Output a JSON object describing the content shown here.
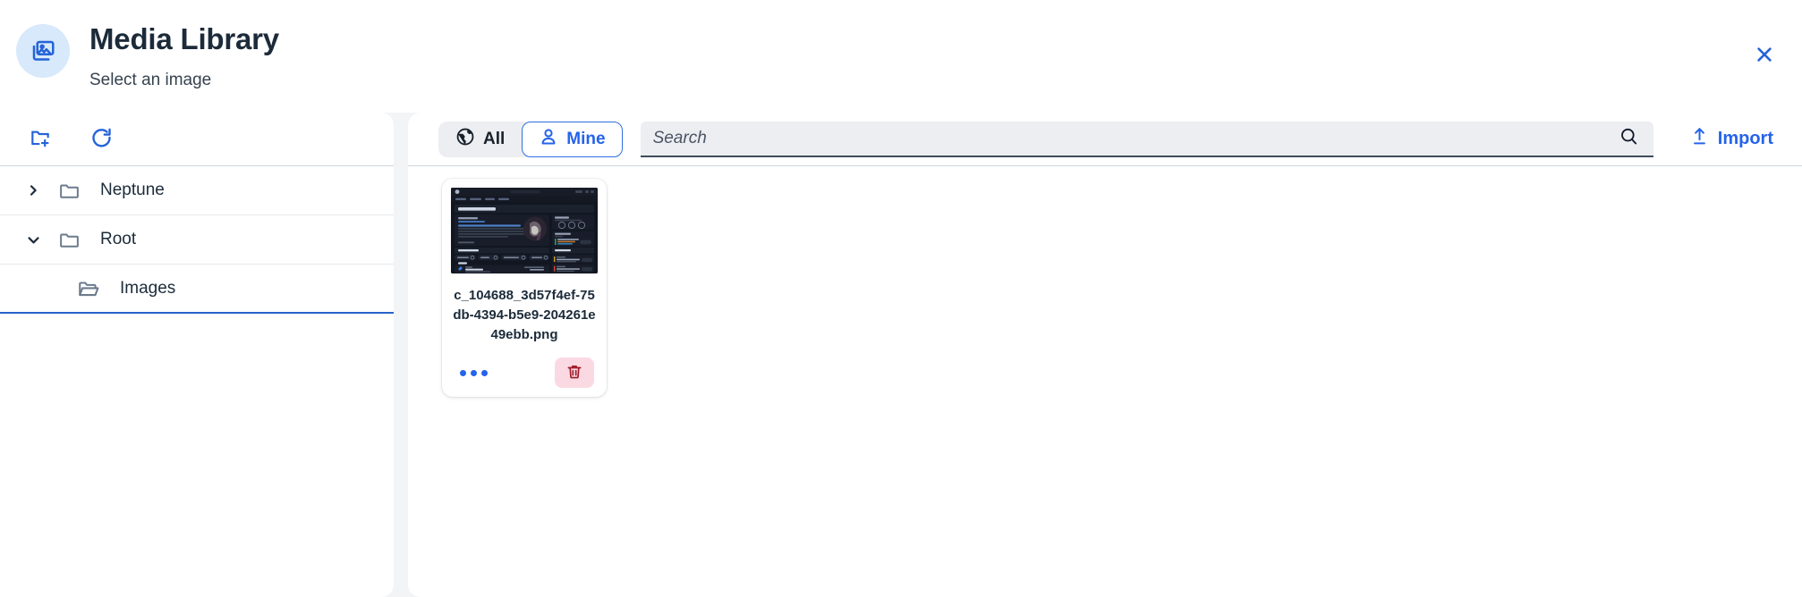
{
  "header": {
    "icon": "media-images-icon",
    "title": "Media Library",
    "subtitle": "Select an image",
    "close_label": "×",
    "badge_bg": "#d7e9fb",
    "accent": "#2563eb",
    "title_color": "#1c2b3a"
  },
  "sidebar": {
    "toolbar": {
      "new_folder_icon": "folder-plus-icon",
      "refresh_icon": "refresh-icon"
    },
    "tree": [
      {
        "label": "Neptune",
        "caret": "chevron-right-icon",
        "expanded": false,
        "folder_icon": "folder-icon",
        "depth": 0,
        "selected": false
      },
      {
        "label": "Root",
        "caret": "chevron-down-icon",
        "expanded": true,
        "folder_icon": "folder-icon",
        "depth": 0,
        "selected": false
      },
      {
        "label": "Images",
        "caret": "",
        "expanded": false,
        "folder_icon": "folder-open-icon",
        "depth": 1,
        "selected": true
      }
    ]
  },
  "main": {
    "filters": [
      {
        "label": "All",
        "icon": "globe-icon",
        "active": false
      },
      {
        "label": "Mine",
        "icon": "user-icon",
        "active": true
      }
    ],
    "search": {
      "placeholder": "Search",
      "value": "",
      "icon": "search-icon"
    },
    "import": {
      "label": "Import",
      "icon": "upload-icon"
    },
    "items": [
      {
        "name": "c_104688_3d57f4ef-75db-4394-b5e9-204261e49ebb.png",
        "thumbnail_alt": "dark-dashboard-screenshot",
        "more_icon": "more-dots-icon",
        "delete_icon": "trash-icon"
      }
    ]
  },
  "thumbnail_content": {
    "greeting": "Good Morning, Dude",
    "sections": [
      "Space Name",
      "Quick Links",
      "To Do",
      "Happiness",
      "Todays Calendar",
      "Notifications"
    ],
    "nav": [
      "My Space",
      "Calendar",
      "My Team",
      "Services"
    ],
    "quick_links": [
      "All Dashboard",
      "Tools",
      "Change Password",
      "VPN Access"
    ],
    "todo_items": [
      "Reset Password",
      "Reset Password",
      "Reset Password"
    ]
  },
  "colors": {
    "body_bg": "#f3f4f6",
    "panel_bg": "#ffffff",
    "divider": "#cfd5dd",
    "accent_blue": "#2563eb",
    "delete_bg": "#fbd9e3",
    "delete_fg": "#a01b28",
    "selected_underline": "#2563c9"
  }
}
